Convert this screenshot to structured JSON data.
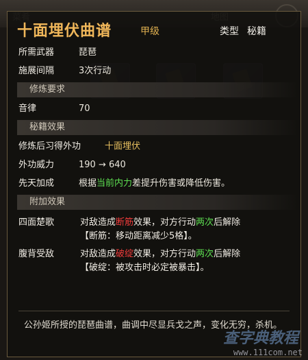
{
  "background": {
    "tabs": [
      "菜肴",
      "地图"
    ]
  },
  "item": {
    "name": "十面埋伏曲谱",
    "grade": "甲级",
    "type_label": "类型",
    "type_value": "秘籍",
    "required_weapon_label": "所需武器",
    "required_weapon": "琵琶",
    "cast_interval_label": "施展间隔",
    "cast_interval": "3次行动"
  },
  "training": {
    "section_title": "修炼要求",
    "rows": [
      {
        "label": "音律",
        "value": "70"
      }
    ]
  },
  "book_effect": {
    "section_title": "秘籍效果",
    "learn_label": "修炼后习得外功",
    "learn_value": "十面埋伏",
    "power_label": "外功威力",
    "power_value": "190 → 640",
    "pre_label": "先天加成",
    "pre_text_a": "根据",
    "pre_text_b": "当前内力",
    "pre_text_c": "差提升伤害或降低伤害。"
  },
  "extra_effect": {
    "section_title": "附加效果",
    "effects": [
      {
        "label": "四面楚歌",
        "l1a": "对敌造成",
        "l1b": "断筋",
        "l1c": "效果，对方行动",
        "l1d": "两次",
        "l1e": "后解除",
        "l2": "【断筋：移动距离减少5格】。"
      },
      {
        "label": "腹背受敌",
        "l1a": "对敌造成",
        "l1b": "破绽",
        "l1c": "效果，对方行动",
        "l1d": "两次",
        "l1e": "后解除",
        "l2": "【破绽：被攻击时必定被暴击】。"
      }
    ]
  },
  "description": "公孙姬所授的琵琶曲谱，曲调中尽显兵戈之声，变化无穷，杀机。",
  "watermark": {
    "text": "查字典教程",
    "url": "www.111com.net"
  },
  "colors": {
    "title": "#f0b75a",
    "gold": "#e8c060",
    "red": "#ee3b3b",
    "green": "#5ee052",
    "panel_border": "#6a5a3e"
  }
}
